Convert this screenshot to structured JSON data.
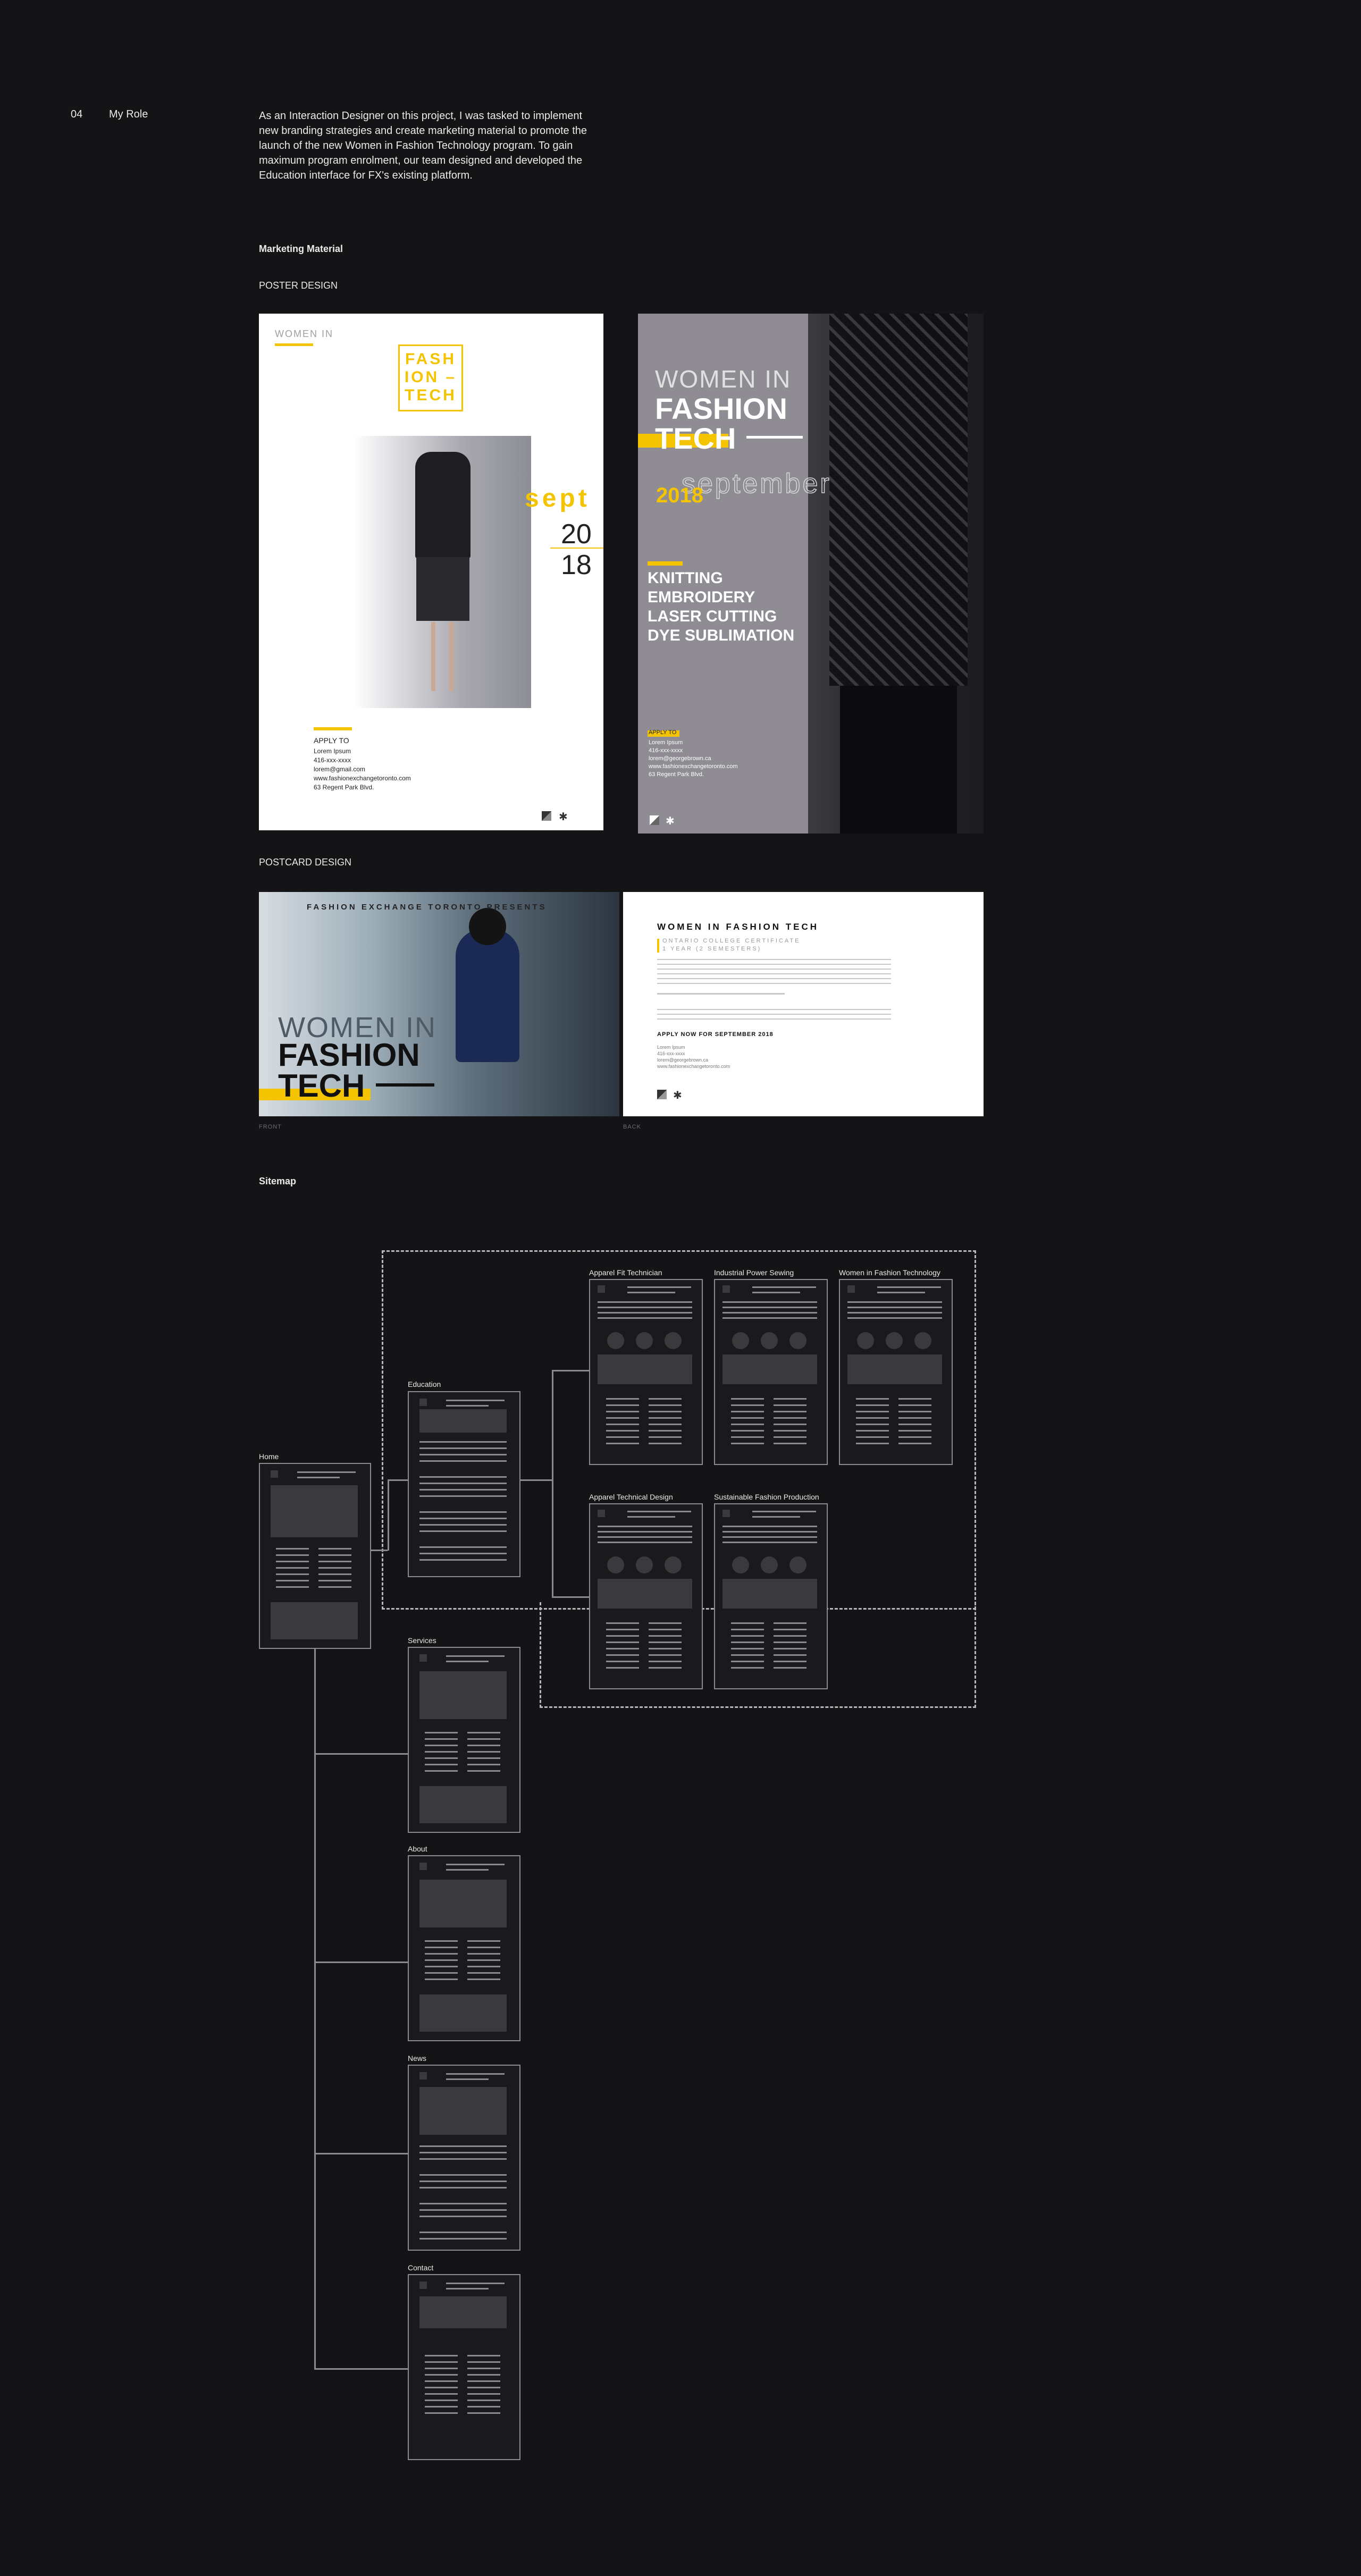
{
  "section_number": "04",
  "section_title": "My Role",
  "intro": "As an Interaction Designer on this project, I was tasked to implement new branding strategies and create marketing material to promote the launch of the new Women in Fashion Technology program. To gain maximum program enrolment, our team designed and developed the Education interface for FX's existing platform.",
  "marketing_heading": "Marketing Material",
  "poster_heading": "POSTER DESIGN",
  "poster1": {
    "women_in": "WOMEN IN",
    "logo_lines": [
      "FASH",
      "ION –",
      "TECH"
    ],
    "sept": "sept",
    "year1": "20",
    "year2": "18",
    "apply_to": "APPLY TO",
    "contact": [
      "Lorem Ipsum",
      "416-xxx-xxxx",
      "lorem@gmail.com",
      "www.fashionexchangetoronto.com",
      "63 Regent Park Blvd."
    ]
  },
  "poster2": {
    "women_in": "WOMEN IN",
    "fashion": "FASHION",
    "tech": "TECH",
    "september": "september",
    "year": "2018",
    "skills": [
      "KNITTING",
      "EMBROIDERY",
      "LASER CUTTING",
      "DYE SUBLIMATION"
    ],
    "apply_to": "APPLY TO",
    "contact": [
      "Lorem Ipsum",
      "416-xxx-xxxx",
      "lorem@georgebrown.ca",
      "www.fashionexchangetoronto.com",
      "63 Regent Park Blvd."
    ]
  },
  "postcard_heading": "POSTCARD DESIGN",
  "postcard_front": {
    "presents": "FASHION EXCHANGE TORONTO PRESENTS",
    "women_in": "WOMEN IN",
    "fashion": "FASHION",
    "tech": "TECH",
    "caption": "FRONT"
  },
  "postcard_back": {
    "title": "WOMEN IN FASHION TECH",
    "subtitle1": "ONTARIO COLLEGE CERTIFICATE",
    "subtitle2": "1 YEAR (2 SEMESTERS)",
    "apply": "APPLY NOW FOR SEPTEMBER 2018",
    "contact": [
      "Lorem Ipsum",
      "416-xxx-xxxx",
      "lorem@georgebrown.ca",
      "www.fashionexchangetoronto.com"
    ],
    "caption": "BACK"
  },
  "sitemap_heading": "Sitemap",
  "sitemap": {
    "home": "Home",
    "education": "Education",
    "services": "Services",
    "about": "About",
    "news": "News",
    "contact": "Contact",
    "apparel_fit": "Apparel Fit Technician",
    "industrial": "Industrial Power Sewing",
    "women_ft": "Women in Fashion Technology",
    "apparel_tech": "Apparel Technical Design",
    "sustainable": "Sustainable Fashion Production"
  },
  "colors": {
    "accent": "#f5c400",
    "background": "#141416"
  }
}
